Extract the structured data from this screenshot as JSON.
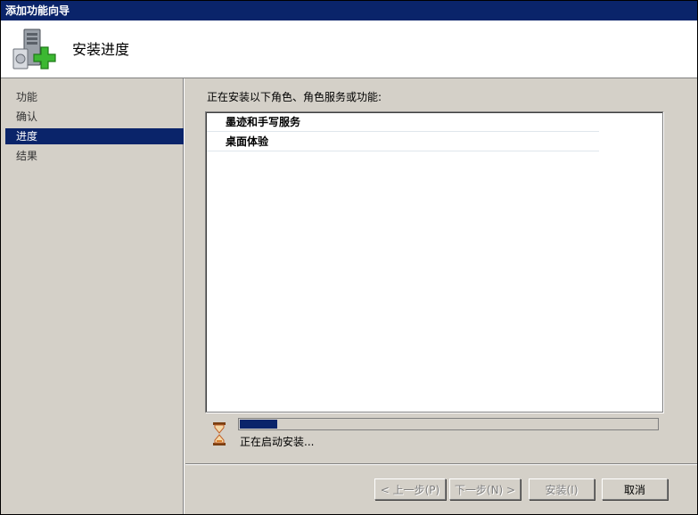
{
  "window": {
    "title": "添加功能向导"
  },
  "header": {
    "title": "安装进度",
    "icon": "server-add-icon"
  },
  "sidebar": {
    "items": [
      {
        "label": "功能",
        "active": false
      },
      {
        "label": "确认",
        "active": false
      },
      {
        "label": "进度",
        "active": true
      },
      {
        "label": "结果",
        "active": false
      }
    ]
  },
  "main": {
    "label": "正在安装以下角色、角色服务或功能:",
    "items": [
      "墨迹和手写服务",
      "桌面体验"
    ],
    "progress": {
      "percent": 9,
      "status": "正在启动安装..."
    }
  },
  "footer": {
    "prev_label": "< 上一步(P)",
    "next_label": "下一步(N) >",
    "install_label": "安装(I)",
    "cancel_label": "取消"
  },
  "colors": {
    "accent": "#0a246a",
    "face": "#d4d0c8"
  }
}
